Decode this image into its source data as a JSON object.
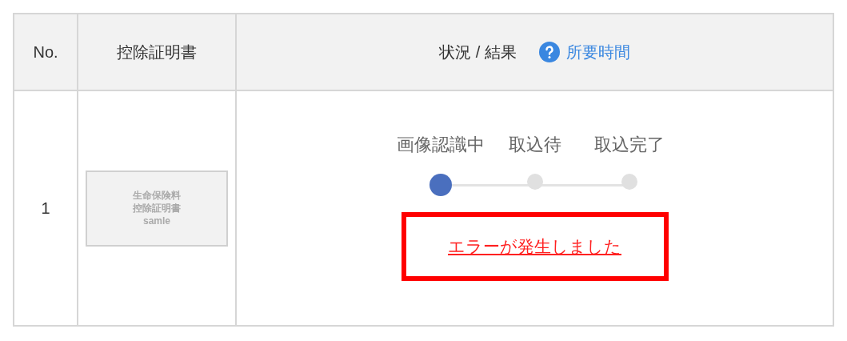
{
  "table": {
    "columns": [
      {
        "label": "No."
      },
      {
        "label": "控除証明書"
      },
      {
        "label": "状況 / 結果",
        "help_link": "所要時間"
      }
    ],
    "rows": [
      {
        "no": "1",
        "certificate": {
          "lines": [
            "生命保険料",
            "控除証明書",
            "samle"
          ]
        },
        "steps": [
          {
            "label": "画像認識中",
            "active": true
          },
          {
            "label": "取込待",
            "active": false
          },
          {
            "label": "取込完了",
            "active": false
          }
        ],
        "error_link": "エラーが発生しました",
        "highlighted": true
      }
    ]
  }
}
